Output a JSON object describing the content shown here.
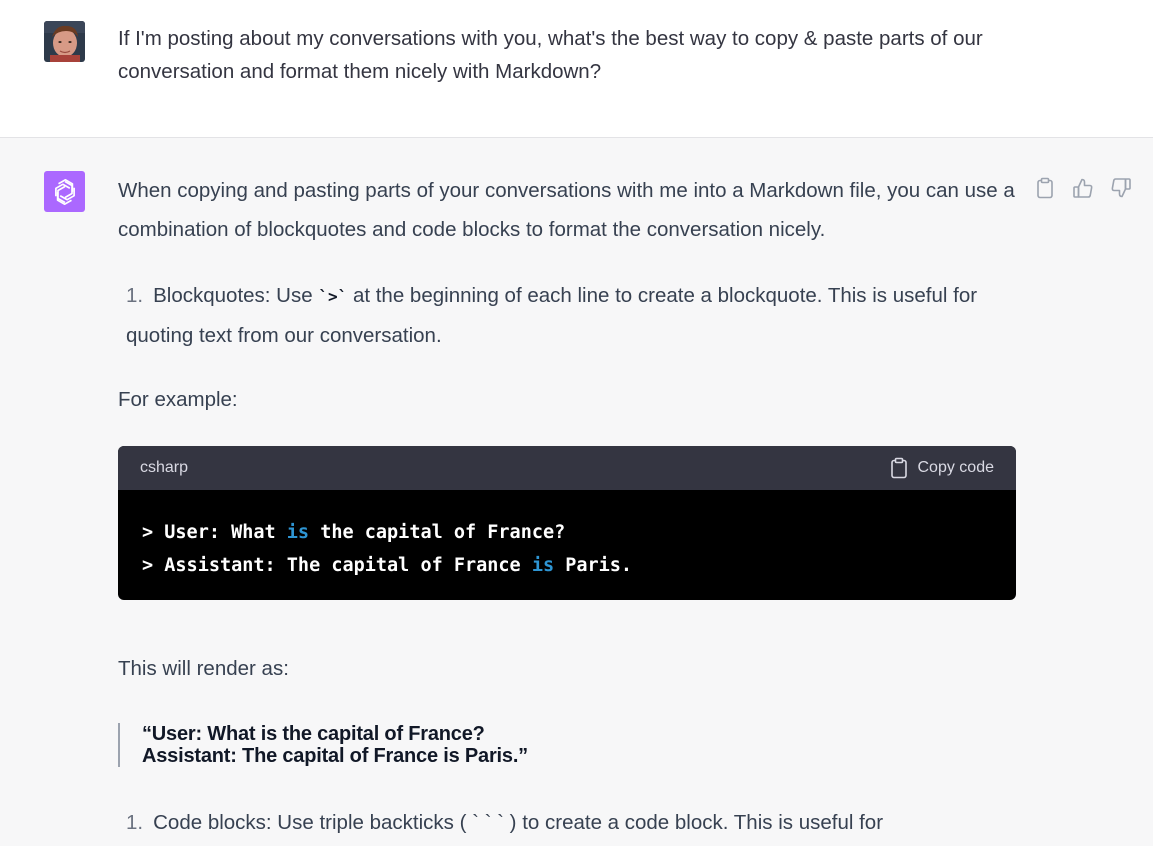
{
  "user_message": {
    "avatar": "user-photo-avatar",
    "text": "If I'm posting about my conversations with you, what's the best way to copy & paste parts of our conversation and format them nicely with Markdown?"
  },
  "assistant_message": {
    "logo": "openai-logo-icon",
    "intro": "When copying and pasting parts of your conversations with me into a Markdown file, you can use a combination of blockquotes and code blocks to format the conversation nicely.",
    "list_item_1": {
      "number": "1.",
      "before": "Blockquotes: Use ",
      "code": "`>`",
      "after": " at the beginning of each line to create a blockquote. This is useful for quoting text from our conversation."
    },
    "for_example": "For example:",
    "code_block": {
      "language": "csharp",
      "copy_label": "Copy code",
      "line1": {
        "a": "> User: What ",
        "kw": "is",
        "b": " the capital of France?"
      },
      "line2": {
        "a": "> Assistant: The capital of France ",
        "kw": "is",
        "b": " Paris."
      }
    },
    "render_as": "This will render as:",
    "blockquote": {
      "line1": "“User: What is the capital of France?",
      "line2": "Assistant: The capital of France is Paris.”"
    },
    "list_item_2": {
      "number": "1.",
      "text": "Code blocks: Use triple backticks ( ` ` ` ) to create a code block. This is useful for"
    },
    "actions": [
      "clipboard-icon",
      "thumbs-up-icon",
      "thumbs-down-icon"
    ]
  },
  "colors": {
    "assistant_bg": "#f7f7f8",
    "logo_bg": "#ab68ff",
    "code_header_bg": "#343541",
    "code_bg": "#000000",
    "keyword": "#2e95d3"
  }
}
